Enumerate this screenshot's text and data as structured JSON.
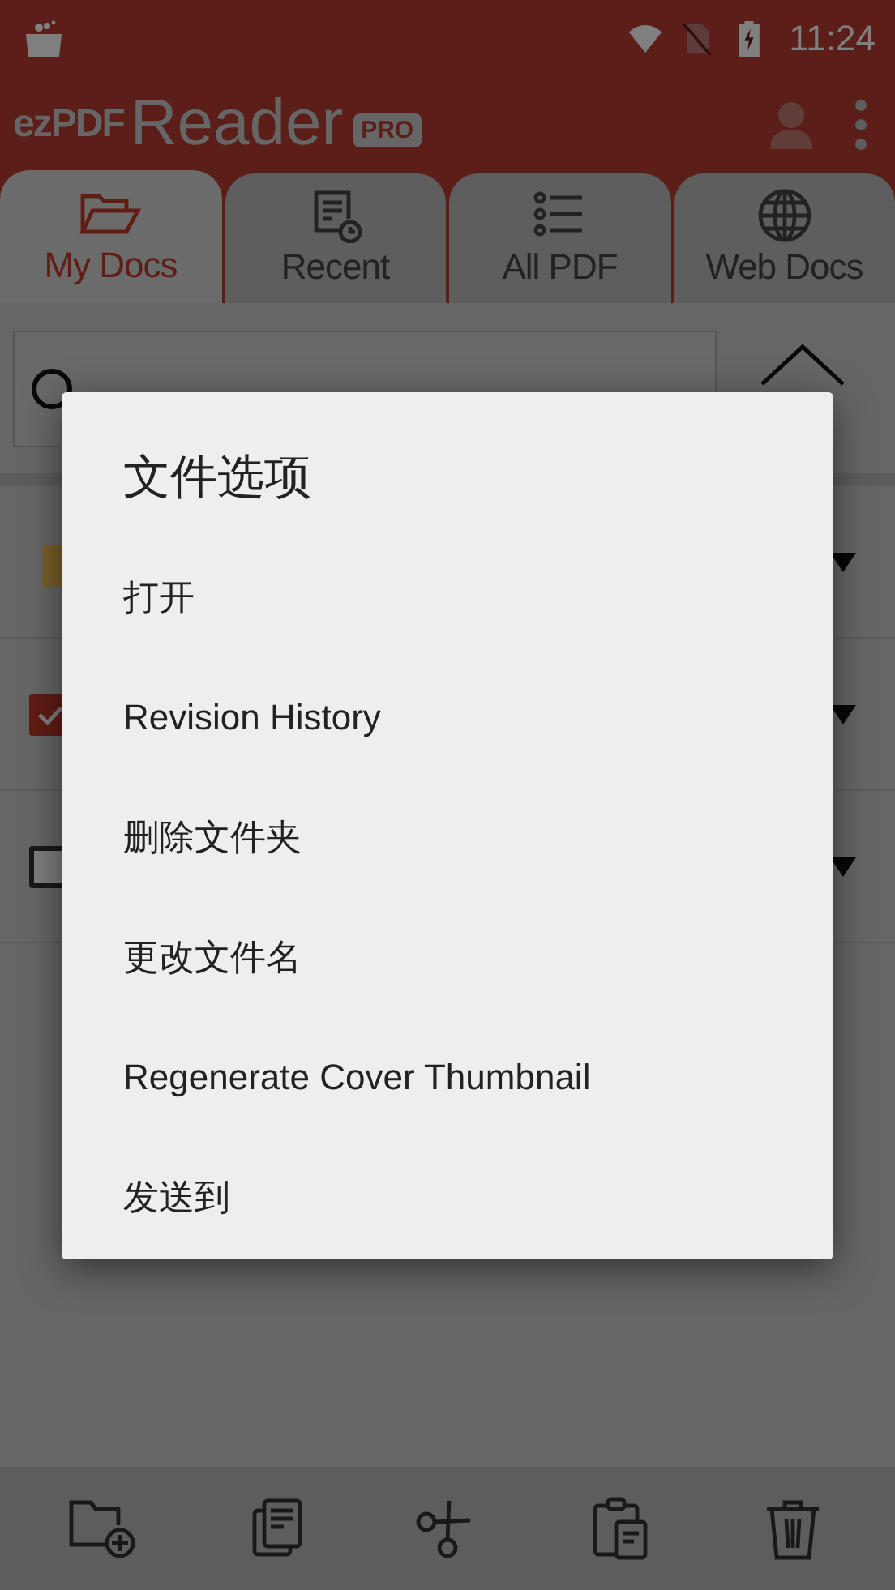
{
  "status_bar": {
    "time": "11:24"
  },
  "app_bar": {
    "logo_prefix": "ezPDF",
    "logo_name": "Reader",
    "badge": "PRO"
  },
  "tabs": [
    {
      "label": "My Docs",
      "selected": true
    },
    {
      "label": "Recent",
      "selected": false
    },
    {
      "label": "All PDF",
      "selected": false
    },
    {
      "label": "Web Docs",
      "selected": false
    }
  ],
  "file_list": [
    {
      "kind": "folder"
    },
    {
      "kind": "file",
      "checked": true
    },
    {
      "kind": "file",
      "checked": false
    }
  ],
  "dialog": {
    "title": "文件选项",
    "items": [
      "打开",
      "Revision History",
      "删除文件夹",
      "更改文件名",
      "Regenerate Cover Thumbnail",
      "发送到"
    ]
  }
}
